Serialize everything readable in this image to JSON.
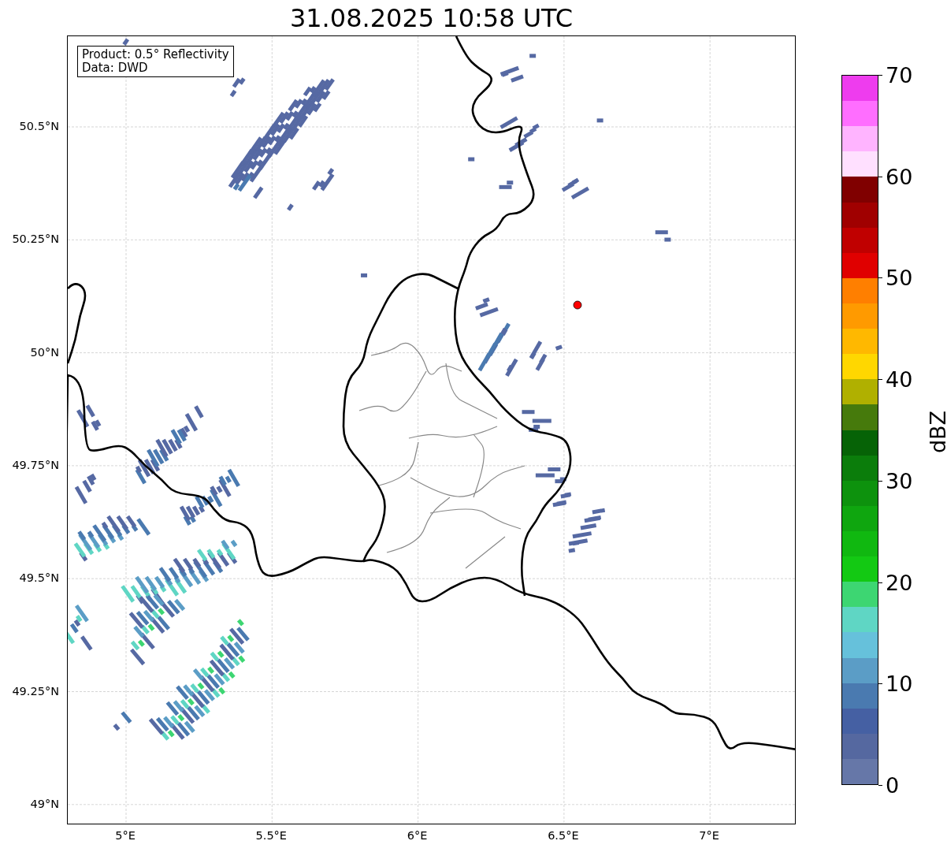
{
  "title": "31.08.2025 10:58 UTC",
  "info_box": [
    "Product: 0.5° Reflectivity",
    "Data: DWD"
  ],
  "latitude_ticks": [
    "50.5°N",
    "50.25°N",
    "50°N",
    "49.75°N",
    "49.5°N",
    "49.25°N",
    "49°N"
  ],
  "longitude_ticks": [
    "5°E",
    "5.5°E",
    "6°E",
    "6.5°E",
    "7°E"
  ],
  "colorbar": {
    "label": "dBZ",
    "ticks": [
      "70",
      "60",
      "50",
      "40",
      "30",
      "20",
      "10",
      "0"
    ],
    "bins": [
      {
        "color": "#ee3cee"
      },
      {
        "color": "#ff6eff"
      },
      {
        "color": "#ffb4ff"
      },
      {
        "color": "#ffe0ff"
      },
      {
        "color": "#800000"
      },
      {
        "color": "#a00000"
      },
      {
        "color": "#c00000"
      },
      {
        "color": "#e00000"
      },
      {
        "color": "#ff7f00"
      },
      {
        "color": "#ff9a00"
      },
      {
        "color": "#ffb800"
      },
      {
        "color": "#ffd700"
      },
      {
        "color": "#b0b000"
      },
      {
        "color": "#467a0c"
      },
      {
        "color": "#066306"
      },
      {
        "color": "#0b7d0b"
      },
      {
        "color": "#0d920d"
      },
      {
        "color": "#0fa60f"
      },
      {
        "color": "#10b810"
      },
      {
        "color": "#13c913"
      },
      {
        "color": "#3dd672"
      },
      {
        "color": "#5fd6c4"
      },
      {
        "color": "#66c1db"
      },
      {
        "color": "#5b9dc6"
      },
      {
        "color": "#4a7ab0"
      },
      {
        "color": "#4560a3"
      },
      {
        "color": "#5568a0"
      },
      {
        "color": "#6677a8"
      }
    ]
  }
}
